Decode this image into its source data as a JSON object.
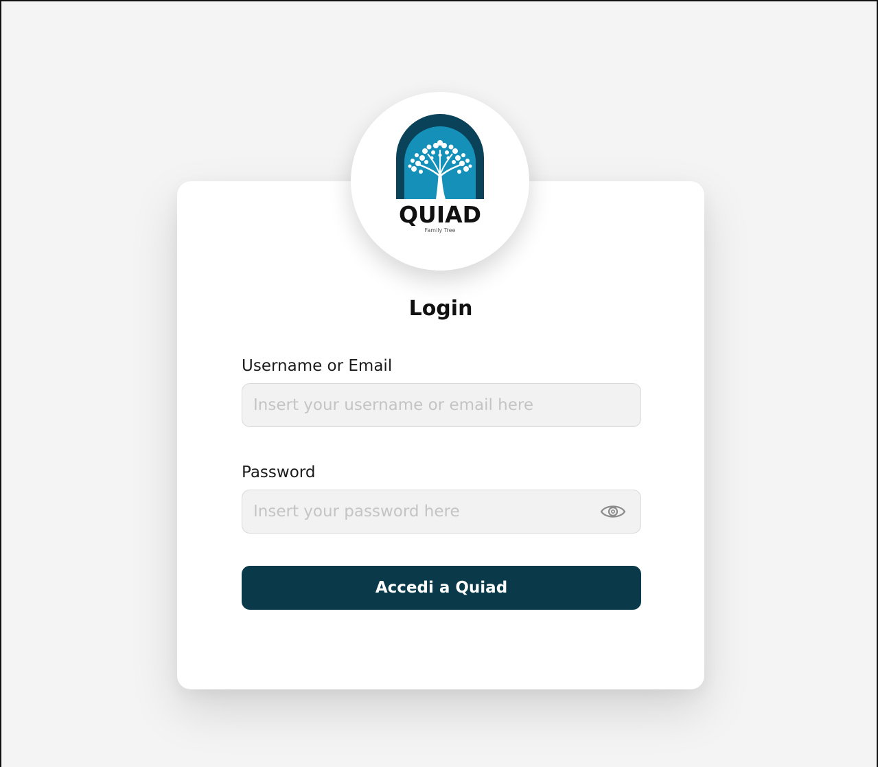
{
  "brand": {
    "name": "QUIAD",
    "tagline": "Family Tree",
    "colors": {
      "arch_outer": "#0a4259",
      "arch_inner": "#1591b9",
      "tree": "#ffffff"
    }
  },
  "login": {
    "title": "Login",
    "username": {
      "label": "Username or Email",
      "placeholder": "Insert your username or email here",
      "value": ""
    },
    "password": {
      "label": "Password",
      "placeholder": "Insert your password here",
      "value": "",
      "toggle_icon": "eye-icon"
    },
    "submit_label": "Accedi a Quiad"
  },
  "colors": {
    "background": "#f4f4f4",
    "card": "#ffffff",
    "primary_button": "#0a3a4a",
    "input_background": "#f2f2f2",
    "input_border": "#d9d9d9",
    "placeholder": "#c4c4c4"
  }
}
